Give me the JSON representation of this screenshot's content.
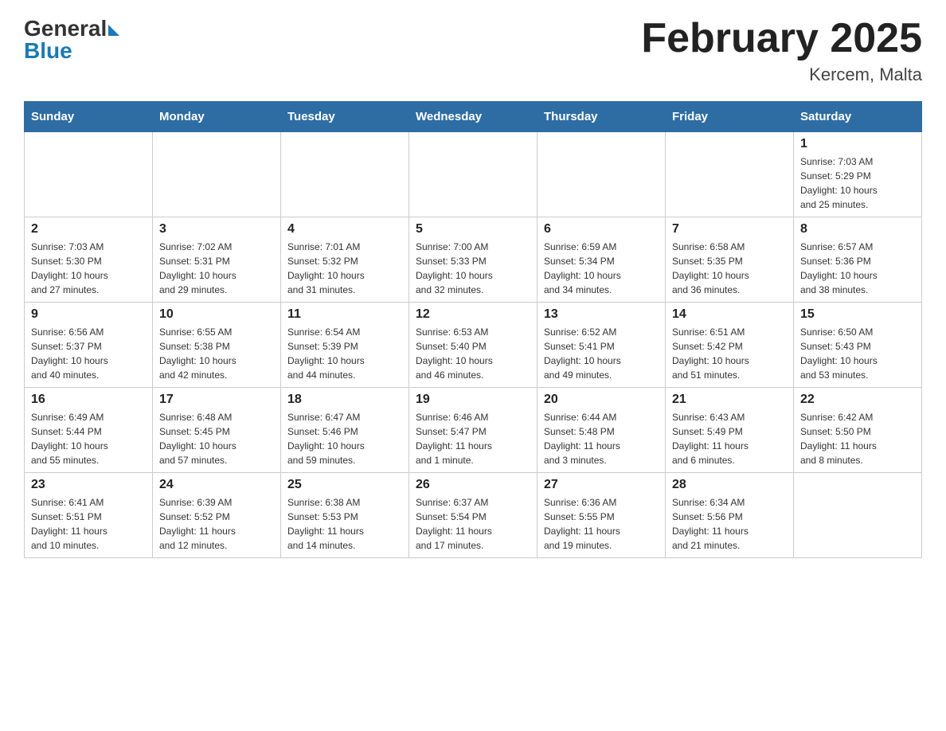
{
  "header": {
    "logo_general": "General",
    "logo_blue": "Blue",
    "title": "February 2025",
    "subtitle": "Kercem, Malta"
  },
  "weekdays": [
    "Sunday",
    "Monday",
    "Tuesday",
    "Wednesday",
    "Thursday",
    "Friday",
    "Saturday"
  ],
  "weeks": [
    [
      {
        "day": "",
        "info": ""
      },
      {
        "day": "",
        "info": ""
      },
      {
        "day": "",
        "info": ""
      },
      {
        "day": "",
        "info": ""
      },
      {
        "day": "",
        "info": ""
      },
      {
        "day": "",
        "info": ""
      },
      {
        "day": "1",
        "info": "Sunrise: 7:03 AM\nSunset: 5:29 PM\nDaylight: 10 hours\nand 25 minutes."
      }
    ],
    [
      {
        "day": "2",
        "info": "Sunrise: 7:03 AM\nSunset: 5:30 PM\nDaylight: 10 hours\nand 27 minutes."
      },
      {
        "day": "3",
        "info": "Sunrise: 7:02 AM\nSunset: 5:31 PM\nDaylight: 10 hours\nand 29 minutes."
      },
      {
        "day": "4",
        "info": "Sunrise: 7:01 AM\nSunset: 5:32 PM\nDaylight: 10 hours\nand 31 minutes."
      },
      {
        "day": "5",
        "info": "Sunrise: 7:00 AM\nSunset: 5:33 PM\nDaylight: 10 hours\nand 32 minutes."
      },
      {
        "day": "6",
        "info": "Sunrise: 6:59 AM\nSunset: 5:34 PM\nDaylight: 10 hours\nand 34 minutes."
      },
      {
        "day": "7",
        "info": "Sunrise: 6:58 AM\nSunset: 5:35 PM\nDaylight: 10 hours\nand 36 minutes."
      },
      {
        "day": "8",
        "info": "Sunrise: 6:57 AM\nSunset: 5:36 PM\nDaylight: 10 hours\nand 38 minutes."
      }
    ],
    [
      {
        "day": "9",
        "info": "Sunrise: 6:56 AM\nSunset: 5:37 PM\nDaylight: 10 hours\nand 40 minutes."
      },
      {
        "day": "10",
        "info": "Sunrise: 6:55 AM\nSunset: 5:38 PM\nDaylight: 10 hours\nand 42 minutes."
      },
      {
        "day": "11",
        "info": "Sunrise: 6:54 AM\nSunset: 5:39 PM\nDaylight: 10 hours\nand 44 minutes."
      },
      {
        "day": "12",
        "info": "Sunrise: 6:53 AM\nSunset: 5:40 PM\nDaylight: 10 hours\nand 46 minutes."
      },
      {
        "day": "13",
        "info": "Sunrise: 6:52 AM\nSunset: 5:41 PM\nDaylight: 10 hours\nand 49 minutes."
      },
      {
        "day": "14",
        "info": "Sunrise: 6:51 AM\nSunset: 5:42 PM\nDaylight: 10 hours\nand 51 minutes."
      },
      {
        "day": "15",
        "info": "Sunrise: 6:50 AM\nSunset: 5:43 PM\nDaylight: 10 hours\nand 53 minutes."
      }
    ],
    [
      {
        "day": "16",
        "info": "Sunrise: 6:49 AM\nSunset: 5:44 PM\nDaylight: 10 hours\nand 55 minutes."
      },
      {
        "day": "17",
        "info": "Sunrise: 6:48 AM\nSunset: 5:45 PM\nDaylight: 10 hours\nand 57 minutes."
      },
      {
        "day": "18",
        "info": "Sunrise: 6:47 AM\nSunset: 5:46 PM\nDaylight: 10 hours\nand 59 minutes."
      },
      {
        "day": "19",
        "info": "Sunrise: 6:46 AM\nSunset: 5:47 PM\nDaylight: 11 hours\nand 1 minute."
      },
      {
        "day": "20",
        "info": "Sunrise: 6:44 AM\nSunset: 5:48 PM\nDaylight: 11 hours\nand 3 minutes."
      },
      {
        "day": "21",
        "info": "Sunrise: 6:43 AM\nSunset: 5:49 PM\nDaylight: 11 hours\nand 6 minutes."
      },
      {
        "day": "22",
        "info": "Sunrise: 6:42 AM\nSunset: 5:50 PM\nDaylight: 11 hours\nand 8 minutes."
      }
    ],
    [
      {
        "day": "23",
        "info": "Sunrise: 6:41 AM\nSunset: 5:51 PM\nDaylight: 11 hours\nand 10 minutes."
      },
      {
        "day": "24",
        "info": "Sunrise: 6:39 AM\nSunset: 5:52 PM\nDaylight: 11 hours\nand 12 minutes."
      },
      {
        "day": "25",
        "info": "Sunrise: 6:38 AM\nSunset: 5:53 PM\nDaylight: 11 hours\nand 14 minutes."
      },
      {
        "day": "26",
        "info": "Sunrise: 6:37 AM\nSunset: 5:54 PM\nDaylight: 11 hours\nand 17 minutes."
      },
      {
        "day": "27",
        "info": "Sunrise: 6:36 AM\nSunset: 5:55 PM\nDaylight: 11 hours\nand 19 minutes."
      },
      {
        "day": "28",
        "info": "Sunrise: 6:34 AM\nSunset: 5:56 PM\nDaylight: 11 hours\nand 21 minutes."
      },
      {
        "day": "",
        "info": ""
      }
    ]
  ]
}
